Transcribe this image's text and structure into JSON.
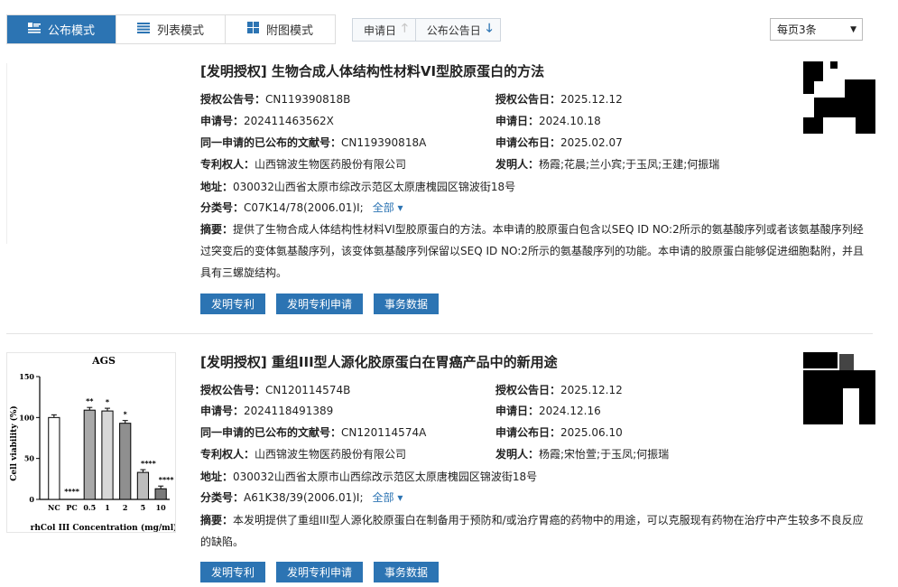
{
  "toolbar": {
    "tabs": [
      {
        "label": "公布模式",
        "active": true
      },
      {
        "label": "列表模式",
        "active": false
      },
      {
        "label": "附图模式",
        "active": false
      }
    ],
    "sort": [
      {
        "label": "申请日",
        "direction": "up",
        "active": false
      },
      {
        "label": "公布公告日",
        "direction": "down",
        "active": true
      }
    ],
    "per_page": "每页3条",
    "colors": {
      "accent": "#2c74b3"
    }
  },
  "records": [
    {
      "title": "[发明授权] 生物合成人体结构性材料VI型胶原蛋白的方法",
      "left": [
        {
          "label": "授权公告号：",
          "value": "CN119390818B"
        },
        {
          "label": "申请号：",
          "value": "202411463562X"
        },
        {
          "label": "同一申请的已公布的文献号：",
          "value": "CN119390818A"
        },
        {
          "label": "专利权人：",
          "value": "山西锦波生物医药股份有限公司"
        }
      ],
      "right": [
        {
          "label": "授权公告日：",
          "value": "2025.12.12"
        },
        {
          "label": "申请日：",
          "value": "2024.10.18"
        },
        {
          "label": "申请公布日：",
          "value": "2025.02.07"
        },
        {
          "label": "发明人：",
          "value": "杨霞;花晨;兰小宾;于玉凤;王建;何振瑞"
        }
      ],
      "address_label": "地址：",
      "address": "030032山西省太原市综改示范区太原唐槐园区锦波街18号",
      "class_label": "分类号：",
      "class_value": "C07K14/78(2006.01)I;",
      "all_label": "全部 ▾",
      "abstract_label": "摘要：",
      "abstract": "提供了生物合成人体结构性材料VI型胶原蛋白的方法。本申请的胶原蛋白包含以SEQ ID NO:2所示的氨基酸序列或者该氨基酸序列经过突变后的变体氨基酸序列，该变体氨基酸序列保留以SEQ ID NO:2所示的氨基酸序列的功能。本申请的胶原蛋白能够促进细胞黏附，并且具有三螺旋结构。",
      "buttons": [
        "发明专利",
        "发明专利申请",
        "事务数据"
      ]
    },
    {
      "title": "[发明授权] 重组III型人源化胶原蛋白在胃癌产品中的新用途",
      "left": [
        {
          "label": "授权公告号：",
          "value": "CN120114574B"
        },
        {
          "label": "申请号：",
          "value": "2024118491389"
        },
        {
          "label": "同一申请的已公布的文献号：",
          "value": "CN120114574A"
        },
        {
          "label": "专利权人：",
          "value": "山西锦波生物医药股份有限公司"
        }
      ],
      "right": [
        {
          "label": "授权公告日：",
          "value": "2025.12.12"
        },
        {
          "label": "申请日：",
          "value": "2024.12.16"
        },
        {
          "label": "申请公布日：",
          "value": "2025.06.10"
        },
        {
          "label": "发明人：",
          "value": "杨霞;宋怡萱;于玉凤;何振瑞"
        }
      ],
      "address_label": "地址：",
      "address": "030032山西省太原市山西综改示范区太原唐槐园区锦波街18号",
      "class_label": "分类号：",
      "class_value": "A61K38/39(2006.01)I;",
      "all_label": "全部 ▾",
      "abstract_label": "摘要：",
      "abstract": "本发明提供了重组III型人源化胶原蛋白在制备用于预防和/或治疗胃癌的药物中的用途，可以克服现有药物在治疗中产生较多不良反应的缺陷。",
      "buttons": [
        "发明专利",
        "发明专利申请",
        "事务数据"
      ]
    }
  ],
  "figure": {
    "title": "AGS",
    "ylabel": "Cell viability (%)",
    "xlabel": "rhCol III Concentration (mg/ml)",
    "yticks": [
      "0",
      "50",
      "100",
      "150"
    ],
    "categories": [
      "NC",
      "PC",
      "0.5",
      "1",
      "2",
      "5",
      "10"
    ],
    "values": [
      100,
      0,
      109,
      108,
      93,
      33,
      13
    ],
    "sig": [
      "",
      "****",
      "**",
      "*",
      "*",
      "****",
      "****"
    ],
    "ylim": [
      0,
      150
    ],
    "bar_colors": [
      "#ffffff",
      "#ffffff",
      "#a9a9a9",
      "#d8d8d8",
      "#8f8f8f",
      "#bdbdbd",
      "#7a7a7a"
    ]
  }
}
